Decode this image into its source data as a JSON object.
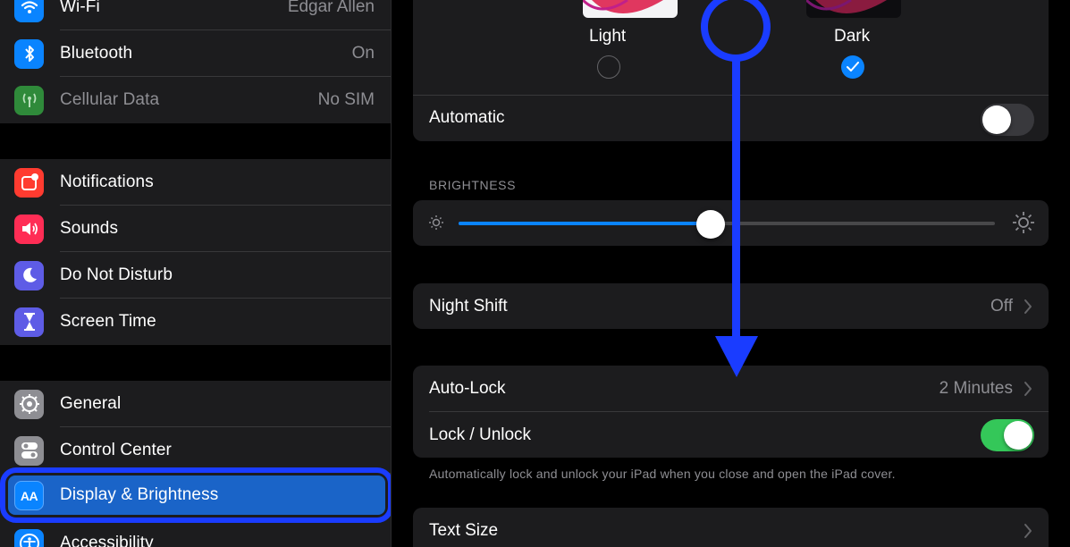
{
  "sidebar": {
    "group1": [
      {
        "label": "Wi-Fi",
        "value": "Edgar Allen",
        "icon": "wifi-icon",
        "color": "#0a84ff"
      },
      {
        "label": "Bluetooth",
        "value": "On",
        "icon": "bluetooth-icon",
        "color": "#0a84ff"
      },
      {
        "label": "Cellular Data",
        "value": "No SIM",
        "icon": "cellular-icon",
        "color": "#2f8a3a"
      }
    ],
    "group2": [
      {
        "label": "Notifications",
        "icon": "notifications-icon",
        "color": "#ff3b30"
      },
      {
        "label": "Sounds",
        "icon": "sounds-icon",
        "color": "#ff2d55"
      },
      {
        "label": "Do Not Disturb",
        "icon": "moon-icon",
        "color": "#5e5ce6"
      },
      {
        "label": "Screen Time",
        "icon": "hourglass-icon",
        "color": "#5e5ce6"
      }
    ],
    "group3": [
      {
        "label": "General",
        "icon": "gear-icon",
        "color": "#8e8e93"
      },
      {
        "label": "Control Center",
        "icon": "switches-icon",
        "color": "#8e8e93"
      },
      {
        "label": "Display & Brightness",
        "icon": "text-size-icon",
        "color": "#0a84ff"
      },
      {
        "label": "Accessibility",
        "icon": "accessibility-icon",
        "color": "#0a84ff"
      }
    ]
  },
  "main": {
    "appearance": {
      "light_label": "Light",
      "dark_label": "Dark",
      "selected": "Dark",
      "automatic_label": "Automatic",
      "automatic_on": false
    },
    "brightness": {
      "section_label": "BRIGHTNESS",
      "level": 0.47
    },
    "night_shift": {
      "label": "Night Shift",
      "value": "Off"
    },
    "auto_lock": {
      "label": "Auto-Lock",
      "value": "2 Minutes"
    },
    "lock_unlock": {
      "label": "Lock / Unlock",
      "on": true
    },
    "lock_note": "Automatically lock and unlock your iPad when you close and open the iPad cover.",
    "text_size": {
      "label": "Text Size"
    }
  },
  "colors": {
    "accent": "#0a84ff",
    "annotation": "#1a3cff",
    "toggle_on": "#34c759"
  }
}
